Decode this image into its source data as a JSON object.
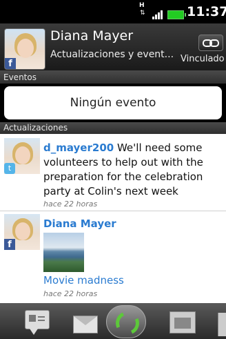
{
  "status_bar": {
    "data_indicator": "H",
    "time": "11:37",
    "icons": [
      "data-activity-icon",
      "signal-strength-icon",
      "battery-icon"
    ]
  },
  "contact": {
    "name": "Diana Mayer",
    "subtitle": "Actualizaciones y event...",
    "link_status": "Vinculado",
    "avatar_badge_icon": "facebook-badge-icon",
    "link_icon": "chain-link-icon"
  },
  "events_section": {
    "header": "Eventos",
    "empty_message": "Ningún evento"
  },
  "updates_section": {
    "header": "Actualizaciones",
    "items": [
      {
        "user": "d_mayer200",
        "text": "We'll need some volunteers to help out with the preparation for the celebration party at Colin's next week",
        "time": "hace 22 horas",
        "source_icon": "twitter-badge-icon"
      },
      {
        "user": "Diana Mayer",
        "link_text": "Movie madness",
        "time": "hace 22 horas",
        "source_icon": "facebook-badge-icon",
        "has_photo": true
      }
    ]
  },
  "tab_bar": {
    "tabs": [
      "message-tab-icon",
      "mail-tab-icon",
      "sync-tab-icon",
      "media-tab-icon",
      "more-tab-icon"
    ]
  },
  "colors": {
    "link_blue": "#2a7bd0",
    "sync_green": "#5dc83a",
    "facebook_blue": "#3b5998"
  }
}
